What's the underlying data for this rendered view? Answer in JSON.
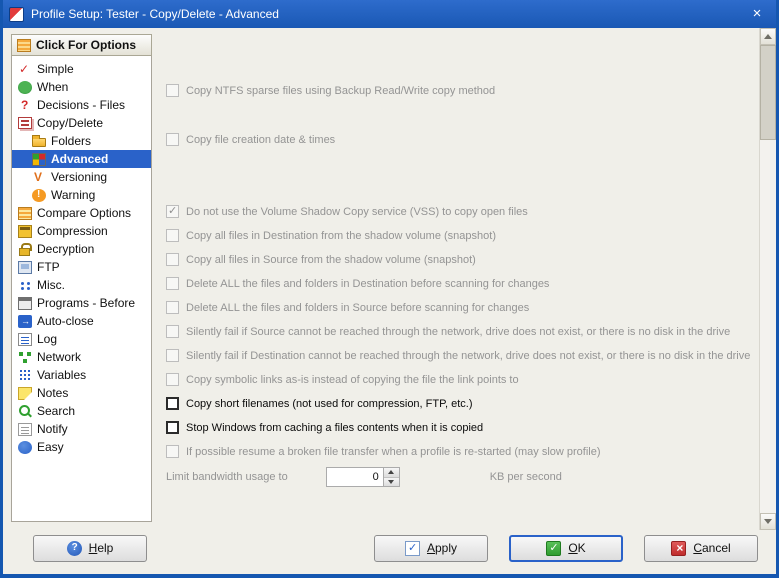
{
  "window": {
    "title": "Profile Setup: Tester - Copy/Delete - Advanced",
    "close_glyph": "×"
  },
  "colors": {
    "titlebar_blue": "#1a58b4",
    "window_border_blue": "#1557b0",
    "selection_blue": "#2a62c9",
    "window_bg": "#f0efe9",
    "disabled_text": "#949494"
  },
  "sidebar": {
    "header": "Click For Options",
    "header_icon": "options-list-icon",
    "items": [
      {
        "label": "Simple",
        "icon": "simple-icon",
        "indent": 0,
        "selected": false
      },
      {
        "label": "When",
        "icon": "when-icon",
        "indent": 0,
        "selected": false
      },
      {
        "label": "Decisions - Files",
        "icon": "decisions-files-icon",
        "indent": 0,
        "selected": false
      },
      {
        "label": "Copy/Delete",
        "icon": "copy-delete-icon",
        "indent": 0,
        "selected": false
      },
      {
        "label": "Folders",
        "icon": "folders-icon",
        "indent": 1,
        "selected": false
      },
      {
        "label": "Advanced",
        "icon": "advanced-icon",
        "indent": 1,
        "selected": true
      },
      {
        "label": "Versioning",
        "icon": "versioning-icon",
        "indent": 1,
        "selected": false
      },
      {
        "label": "Warning",
        "icon": "warning-icon",
        "indent": 1,
        "selected": false
      },
      {
        "label": "Compare Options",
        "icon": "compare-options-icon",
        "indent": 0,
        "selected": false
      },
      {
        "label": "Compression",
        "icon": "compression-icon",
        "indent": 0,
        "selected": false
      },
      {
        "label": "Decryption",
        "icon": "decryption-icon",
        "indent": 0,
        "selected": false
      },
      {
        "label": "FTP",
        "icon": "ftp-icon",
        "indent": 0,
        "selected": false
      },
      {
        "label": "Misc.",
        "icon": "misc-icon",
        "indent": 0,
        "selected": false
      },
      {
        "label": "Programs - Before",
        "icon": "programs-before-icon",
        "indent": 0,
        "selected": false
      },
      {
        "label": "Auto-close",
        "icon": "auto-close-icon",
        "indent": 0,
        "selected": false
      },
      {
        "label": "Log",
        "icon": "log-icon",
        "indent": 0,
        "selected": false
      },
      {
        "label": "Network",
        "icon": "network-icon",
        "indent": 0,
        "selected": false
      },
      {
        "label": "Variables",
        "icon": "variables-icon",
        "indent": 0,
        "selected": false
      },
      {
        "label": "Notes",
        "icon": "notes-icon",
        "indent": 0,
        "selected": false
      },
      {
        "label": "Search",
        "icon": "search-icon",
        "indent": 0,
        "selected": false
      },
      {
        "label": "Notify",
        "icon": "notify-icon",
        "indent": 0,
        "selected": false
      },
      {
        "label": "Easy",
        "icon": "easy-icon",
        "indent": 0,
        "selected": false
      }
    ]
  },
  "main": {
    "checkboxes": [
      {
        "label": "Copy NTFS sparse files using Backup Read/Write copy method",
        "checked": false,
        "enabled": false
      },
      {
        "label": "Copy file creation date & times",
        "checked": false,
        "enabled": false
      },
      {
        "label": "Do not use the Volume Shadow Copy service (VSS) to copy open files",
        "checked": true,
        "enabled": false
      },
      {
        "label": "Copy all files in Destination from the shadow volume (snapshot)",
        "checked": false,
        "enabled": false
      },
      {
        "label": "Copy all files in Source from the shadow volume (snapshot)",
        "checked": false,
        "enabled": false
      },
      {
        "label": "Delete ALL the files and folders in Destination before scanning for changes",
        "checked": false,
        "enabled": false
      },
      {
        "label": "Delete ALL the files and folders in Source before scanning for changes",
        "checked": false,
        "enabled": false
      },
      {
        "label": "Silently fail if Source cannot be reached through the network, drive does not exist, or there is no disk in the drive",
        "checked": false,
        "enabled": false
      },
      {
        "label": "Silently fail if Destination cannot be reached through the network, drive does not exist, or there is no disk in the drive",
        "checked": false,
        "enabled": false
      },
      {
        "label": "Copy symbolic links as-is instead of copying the file the link points to",
        "checked": false,
        "enabled": false
      },
      {
        "label": "Copy short filenames (not used for compression, FTP, etc.)",
        "checked": false,
        "enabled": true
      },
      {
        "label": "Stop Windows from caching a files contents when it is copied",
        "checked": false,
        "enabled": true
      },
      {
        "label": "If possible resume a broken file transfer when a profile is re-started (may slow profile)",
        "checked": false,
        "enabled": false
      }
    ],
    "bandwidth": {
      "label": "Limit bandwidth usage to",
      "value": "0",
      "suffix": "KB per second"
    }
  },
  "footer": {
    "help": "Help",
    "apply": "Apply",
    "ok": "OK",
    "cancel": "Cancel"
  }
}
